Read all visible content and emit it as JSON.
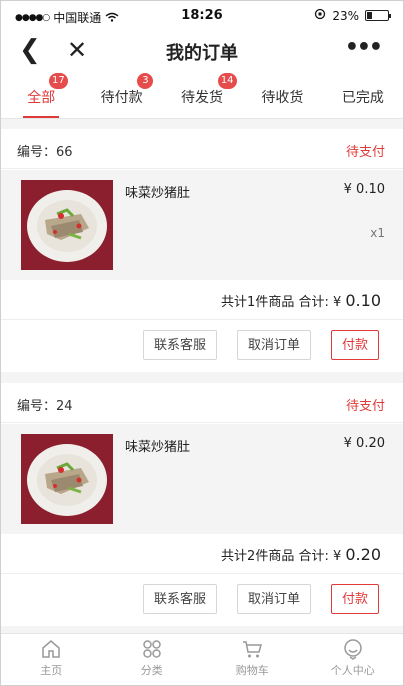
{
  "status_bar": {
    "carrier": "中国联通",
    "time": "18:26",
    "battery": "23%"
  },
  "nav": {
    "title": "我的订单",
    "back_glyph": "❮",
    "close_glyph": "✕",
    "more_glyph": "•••"
  },
  "tabs": [
    {
      "label": "全部",
      "badge": "17",
      "active": true
    },
    {
      "label": "待付款",
      "badge": "3"
    },
    {
      "label": "待发货",
      "badge": "14"
    },
    {
      "label": "待收货",
      "badge": ""
    },
    {
      "label": "已完成",
      "badge": ""
    }
  ],
  "orders": [
    {
      "number_label": "编号：66",
      "status": "待支付",
      "item": {
        "name": "味菜炒猪肚",
        "price": "¥ 0.10",
        "qty": "x1"
      },
      "summary_prefix": "共计1件商品 合计: ¥",
      "summary_total": "0.10",
      "actions": {
        "contact": "联系客服",
        "cancel": "取消订单",
        "pay": "付款"
      }
    },
    {
      "number_label": "编号：24",
      "status": "待支付",
      "item": {
        "name": "味菜炒猪肚",
        "price": "¥ 0.20",
        "qty": ""
      },
      "summary_prefix": "共计2件商品 合计: ¥",
      "summary_total": "0.20",
      "actions": {
        "contact": "联系客服",
        "cancel": "取消订单",
        "pay": "付款"
      }
    }
  ],
  "bottom_tabs": [
    {
      "label": "主页",
      "icon": "home-icon"
    },
    {
      "label": "分类",
      "icon": "category-icon"
    },
    {
      "label": "购物车",
      "icon": "cart-icon"
    },
    {
      "label": "个人中心",
      "icon": "profile-icon"
    }
  ],
  "colors": {
    "accent": "#e03b3b",
    "badge": "#e64c4c",
    "thumb_bg": "#8b1f2e"
  }
}
